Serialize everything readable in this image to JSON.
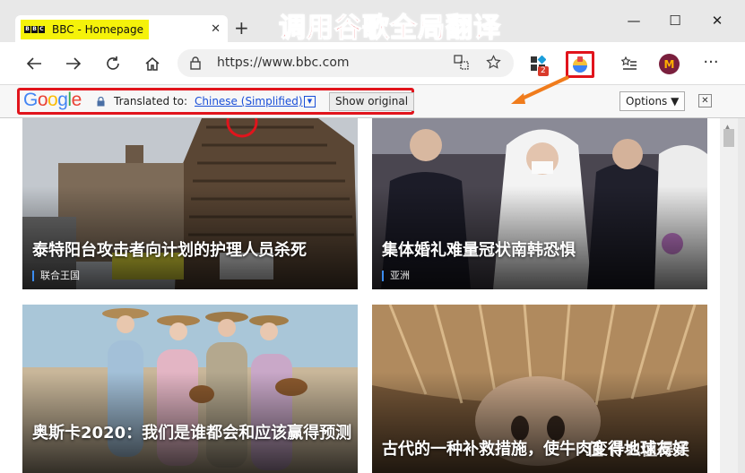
{
  "banner_text": "调用谷歌全局翻译",
  "tab": {
    "logo_letters": [
      "B",
      "B",
      "C"
    ],
    "title": "BBC - Homepage",
    "close": "✕",
    "new_tab": "+"
  },
  "window_controls": {
    "minimize": "—",
    "maximize": "☐",
    "close": "✕"
  },
  "toolbar": {
    "url": "https://www.bbc.com",
    "extension_badge_count": "2",
    "avatar_letter": "M",
    "more": "···"
  },
  "translate_bar": {
    "logo": [
      "G",
      "o",
      "o",
      "g",
      "l",
      "e"
    ],
    "label": "Translated to:",
    "language": "Chinese (Simplified)",
    "dropdown": "▼",
    "show_original": "Show original",
    "options": "Options ▼",
    "close": "✕"
  },
  "colors": {
    "highlight_red": "#e1141c",
    "google_blue": "#4285f4",
    "google_red": "#ea4335",
    "google_yellow": "#fbbc05",
    "google_green": "#34a853",
    "tag_bar": "#3b8cf0",
    "arrow_orange": "#f07c1c"
  },
  "cards": [
    {
      "headline": "泰特阳台攻击者向计划的护理人员杀死",
      "tag": "联合王国"
    },
    {
      "headline": "集体婚礼难量冠状南韩恐惧",
      "tag": "亚洲"
    },
    {
      "headline": "奥斯卡2020：我们是谁都会和应该赢得预测",
      "tag": ""
    },
    {
      "headline": "古代的一种补救措施，使牛肉变得地球友好",
      "tag": ""
    }
  ],
  "watermark": "值 什么值得买"
}
